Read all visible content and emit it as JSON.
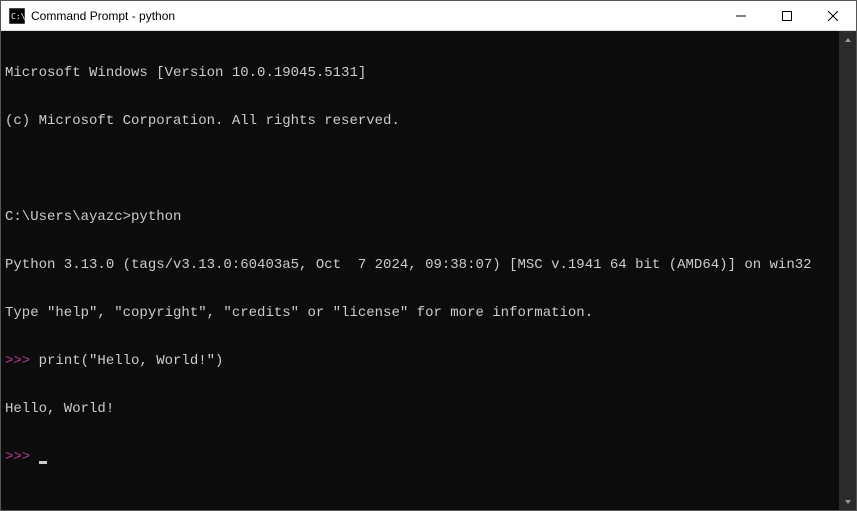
{
  "titlebar": {
    "title": "Command Prompt - python"
  },
  "terminal": {
    "line1": "Microsoft Windows [Version 10.0.19045.5131]",
    "line2": "(c) Microsoft Corporation. All rights reserved.",
    "blank1": "",
    "prompt_line": "C:\\Users\\ayazc>python",
    "py_version": "Python 3.13.0 (tags/v3.13.0:60403a5, Oct  7 2024, 09:38:07) [MSC v.1941 64 bit (AMD64)] on win32",
    "py_help": "Type \"help\", \"copyright\", \"credits\" or \"license\" for more information.",
    "repl_prompt1": ">>> ",
    "repl_input1": "print(\"Hello, World!\")",
    "output1": "Hello, World!",
    "repl_prompt2": ">>> "
  }
}
